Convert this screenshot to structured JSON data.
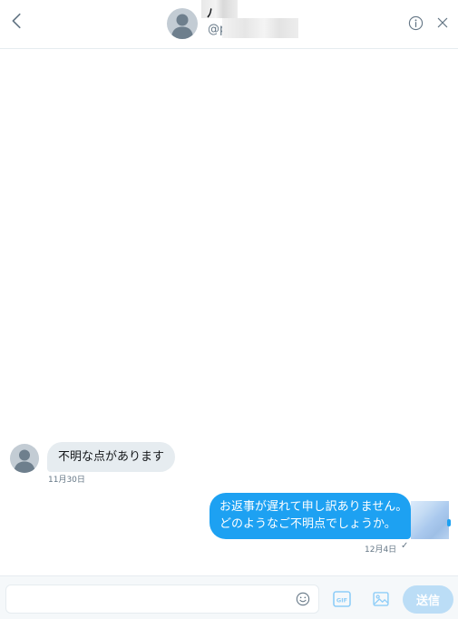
{
  "header": {
    "name": "ﾉ",
    "handle": "@p"
  },
  "messages": {
    "received": {
      "text": "不明な点があります",
      "time": "11月30日"
    },
    "sent": {
      "line1": "お返事が遅れて申し訳ありません。",
      "line2": "どのようなご不明点でしょうか。",
      "time": "12月4日",
      "status": "✓"
    }
  },
  "composer": {
    "input_value": "",
    "gif_label": "GIF",
    "send_label": "送信"
  },
  "colors": {
    "accent": "#1da1f2",
    "bubble_received": "#e6ecf0",
    "send_disabled": "#bbddf6"
  },
  "icons": [
    "chevron-left-icon",
    "info-icon",
    "close-icon",
    "emoji-icon",
    "gif-icon",
    "image-icon",
    "avatar-icon"
  ]
}
